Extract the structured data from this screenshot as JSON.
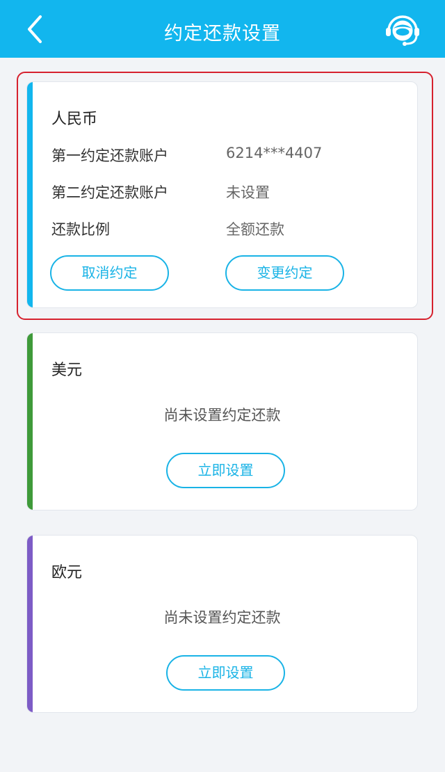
{
  "header": {
    "title": "约定还款设置",
    "back_icon": "chevron-left-icon",
    "service_icon": "customer-service-headset-icon"
  },
  "colors": {
    "header_bg": "#12b6ee",
    "accent_rmb": "#12b6ee",
    "accent_usd": "#3f9a3a",
    "accent_eur": "#7d5cc6",
    "highlight_border": "#d6212e"
  },
  "cards": [
    {
      "currency": "人民币",
      "rows": [
        {
          "label": "第一约定还款账户",
          "value": "6214***4407"
        },
        {
          "label": "第二约定还款账户",
          "value": "未设置"
        },
        {
          "label": "还款比例",
          "value": "全额还款"
        }
      ],
      "cancel_label": "取消约定",
      "change_label": "变更约定"
    },
    {
      "currency": "美元",
      "message": "尚未设置约定还款",
      "setup_label": "立即设置"
    },
    {
      "currency": "欧元",
      "message": "尚未设置约定还款",
      "setup_label": "立即设置"
    }
  ]
}
